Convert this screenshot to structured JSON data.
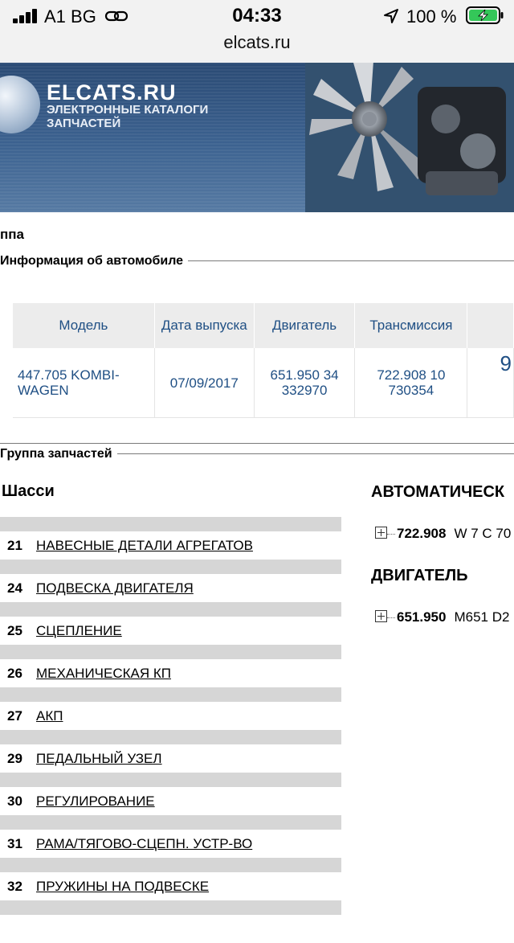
{
  "status_bar": {
    "carrier": "A1 BG",
    "time": "04:33",
    "battery": "100 %",
    "url": "elcats.ru"
  },
  "banner": {
    "logo": "ELCATS.RU",
    "subtitle": "ЭЛЕКТРОННЫЕ КАТАЛОГИ ЗАПЧАСТЕЙ"
  },
  "breadcrumb": "ппа",
  "car_info": {
    "legend": "Информация об автомобиле",
    "headers": [
      "Модель",
      "Дата выпуска",
      "Двигатель",
      "Трансмиссия"
    ],
    "row": {
      "model": "447.705 KOMBI-WAGEN",
      "date": "07/09/2017",
      "engine": "651.950 34 332970",
      "transmission": "722.908 10 730354",
      "extra": "9"
    }
  },
  "parts_group": {
    "legend": "Группа запчастей",
    "chassis_title": "Шасси",
    "items": [
      {
        "num": "21",
        "label": "НАВЕСНЫЕ ДЕТАЛИ АГРЕГАТОВ"
      },
      {
        "num": "24",
        "label": "ПОДВЕСКА ДВИГАТЕЛЯ"
      },
      {
        "num": "25",
        "label": "СЦЕПЛЕНИЕ"
      },
      {
        "num": "26",
        "label": "МЕХАНИЧЕСКАЯ КП"
      },
      {
        "num": "27",
        "label": "АКП"
      },
      {
        "num": "29",
        "label": "ПЕДАЛЬНЫЙ УЗЕЛ"
      },
      {
        "num": "30",
        "label": "РЕГУЛИРОВАНИЕ"
      },
      {
        "num": "31",
        "label": "РАМА/ТЯГОВО-СЦЕПН. УСТР-ВО"
      },
      {
        "num": "32",
        "label": "ПРУЖИНЫ НА ПОДВЕСКЕ"
      }
    ],
    "automatic_title": "АВТОМАТИЧЕСК",
    "automatic_code": "722.908",
    "automatic_desc": "W 7 C 70",
    "engine_title": "ДВИГАТЕЛЬ",
    "engine_code": "651.950",
    "engine_desc": "M651 D2"
  },
  "colors": {
    "link": "#1f4f84",
    "header_bg": "#ececec",
    "row_bar": "#d6d6d6",
    "banner": "#3c6290"
  }
}
